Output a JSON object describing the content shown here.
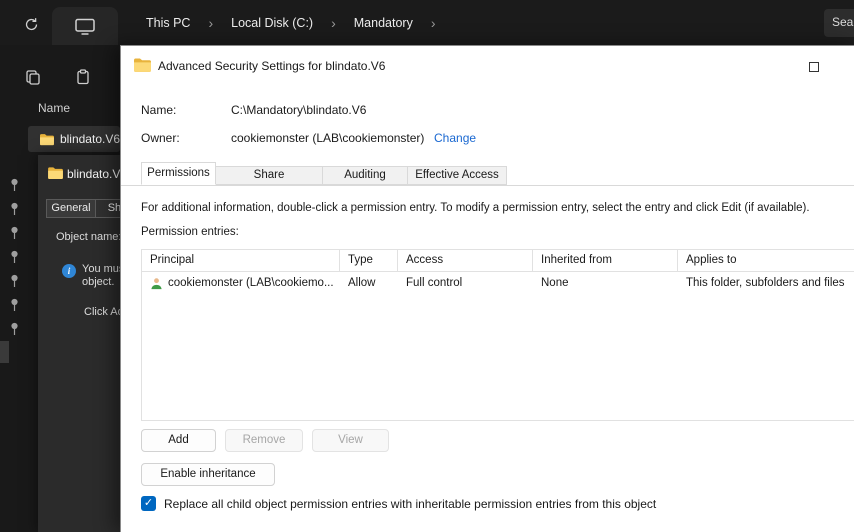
{
  "colors": {
    "accent": "#0067c0",
    "link": "#1a68d1",
    "folder": "#f7c64d",
    "explorer_bg": "#191919",
    "dialog_bg": "#ffffff"
  },
  "explorer": {
    "breadcrumb": {
      "items": [
        "This PC",
        "Local Disk (C:)",
        "Mandatory"
      ],
      "chevron": "›"
    },
    "search": {
      "value": "Sea"
    },
    "list": {
      "name_header": "Name",
      "file_name": "blindato.V6"
    },
    "properties_dialog": {
      "title": "blindato.V",
      "tabs": [
        "General",
        "Sha"
      ],
      "object_name_label": "Object name:",
      "info_icon_glyph": "i",
      "info_line_1": "You mus",
      "info_line_2": "object.",
      "info_line_3": "Click Ad"
    }
  },
  "dialog": {
    "title": "Advanced Security Settings for blindato.V6",
    "name_label": "Name:",
    "name_value": "C:\\Mandatory\\blindato.V6",
    "owner_label": "Owner:",
    "owner_value": "cookiemonster (LAB\\cookiemonster)",
    "change_link": "Change",
    "tabs": [
      "Permissions",
      "Share",
      "Auditing",
      "Effective Access"
    ],
    "selected_tab": "Permissions",
    "instruction": "For additional information, double-click a permission entry. To modify a permission entry, select the entry and click Edit (if available).",
    "entries_label": "Permission entries:",
    "table": {
      "columns": [
        "Principal",
        "Type",
        "Access",
        "Inherited from",
        "Applies to"
      ],
      "rows": [
        {
          "principal": "cookiemonster (LAB\\cookiemo...",
          "type": "Allow",
          "access": "Full control",
          "inherited_from": "None",
          "applies_to": "This folder, subfolders and files"
        }
      ]
    },
    "buttons": {
      "add": "Add",
      "remove": "Remove",
      "view": "View",
      "enable_inheritance": "Enable inheritance"
    },
    "checkbox": {
      "checked": true,
      "glyph": "✓",
      "label": "Replace all child object permission entries with inheritable permission entries from this object"
    }
  }
}
